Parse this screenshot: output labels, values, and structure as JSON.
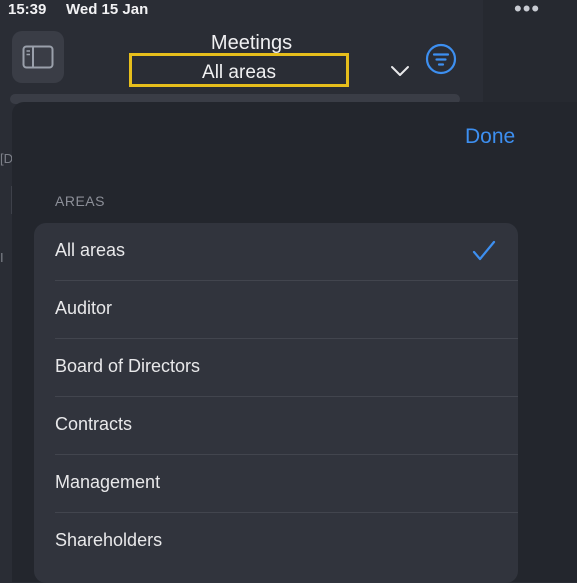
{
  "status": {
    "time": "15:39",
    "date": "Wed 15 Jan",
    "more": "•••"
  },
  "header": {
    "title": "Meetings",
    "selected_area": "All areas"
  },
  "background": {
    "fragment_1": "[D",
    "fragment_2": "I"
  },
  "sheet": {
    "done_label": "Done",
    "section_header": "AREAS",
    "items": [
      {
        "label": "All areas",
        "selected": true
      },
      {
        "label": "Auditor",
        "selected": false
      },
      {
        "label": "Board of Directors",
        "selected": false
      },
      {
        "label": "Contracts",
        "selected": false
      },
      {
        "label": "Management",
        "selected": false
      },
      {
        "label": "Shareholders",
        "selected": false
      }
    ]
  },
  "icons": {
    "sidebar": "sidebar-toggle-icon",
    "chevron": "chevron-down-icon",
    "filter": "filter-icon",
    "check": "checkmark-icon"
  },
  "colors": {
    "accent": "#3d8ff0",
    "highlight": "#e6be1c"
  }
}
